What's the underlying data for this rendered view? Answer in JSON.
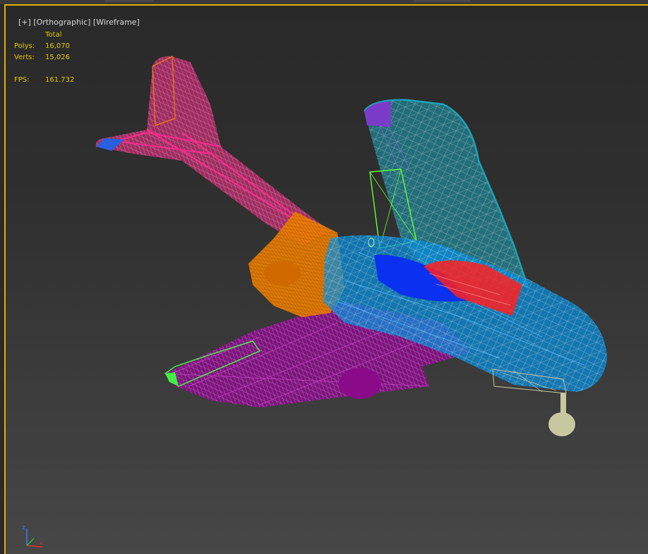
{
  "viewport": {
    "label_plus": "[+]",
    "label_view": "[Orthographic]",
    "label_shading": "[Wireframe]",
    "border_color": "#e0b000"
  },
  "stats": {
    "header": "Total",
    "polys_label": "Polys:",
    "polys_value": "16,070",
    "verts_label": "Verts:",
    "verts_value": "15,026",
    "fps_label": "FPS:",
    "fps_value": "161.732",
    "text_color": "#e2c400"
  },
  "gizmo": {
    "z_label": "z",
    "x_label": "x"
  },
  "model_colors": {
    "fuselage": "#0a8cd8",
    "canopy_dark": "#0a30f0",
    "fin": "#1aa3b8",
    "fin_cap": "#7a3cc8",
    "fin_strut": "#66ff33",
    "intake": "#f08000",
    "tail_boom": "#ff2a8a",
    "wing": "#8a0a8a",
    "wing_tip": "#44ee44",
    "red_panel": "#ff2020",
    "gear": "#c8c8a0"
  }
}
